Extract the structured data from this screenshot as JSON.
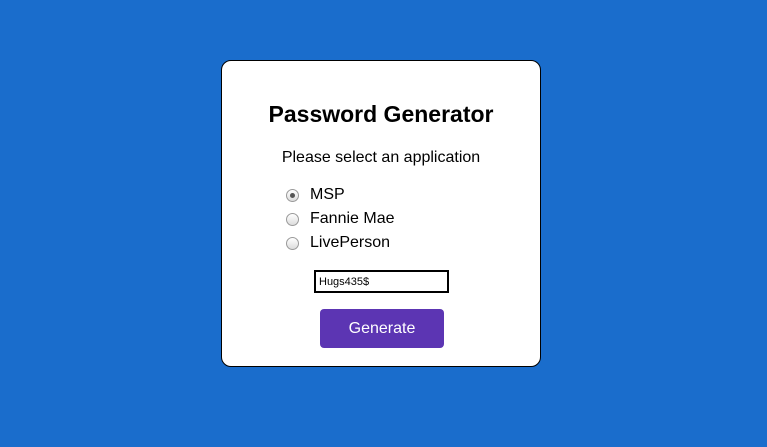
{
  "page": {
    "background_color": "#1a6dcc"
  },
  "card": {
    "title": "Password Generator",
    "prompt": "Please select an application",
    "applications": [
      {
        "label": "MSP",
        "selected": true
      },
      {
        "label": "Fannie Mae",
        "selected": false
      },
      {
        "label": "LivePerson",
        "selected": false
      }
    ],
    "password_value": "Hugs435$",
    "generate_label": "Generate",
    "accent_color": "#5c35b3"
  }
}
